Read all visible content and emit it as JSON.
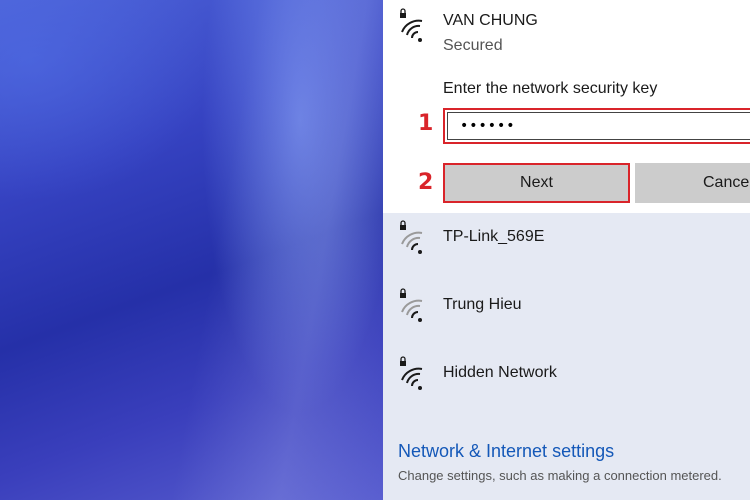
{
  "active_network": {
    "name": "VAN CHUNG",
    "status": "Secured",
    "prompt": "Enter the network security key",
    "key_value": "••••••",
    "next_label": "Next",
    "cancel_label": "Cancel",
    "icon": "wifi-secured-icon"
  },
  "annotations": {
    "step1": "1",
    "step2": "2",
    "highlight_color": "#d9242a"
  },
  "networks": [
    {
      "name": "TP-Link_569E",
      "icon": "wifi-secured-icon"
    },
    {
      "name": "Trung Hieu",
      "icon": "wifi-secured-icon"
    },
    {
      "name": "Hidden Network",
      "icon": "wifi-secured-icon"
    }
  ],
  "footer": {
    "settings_link": "Network & Internet settings",
    "settings_desc": "Change settings, such as making a connection metered."
  }
}
